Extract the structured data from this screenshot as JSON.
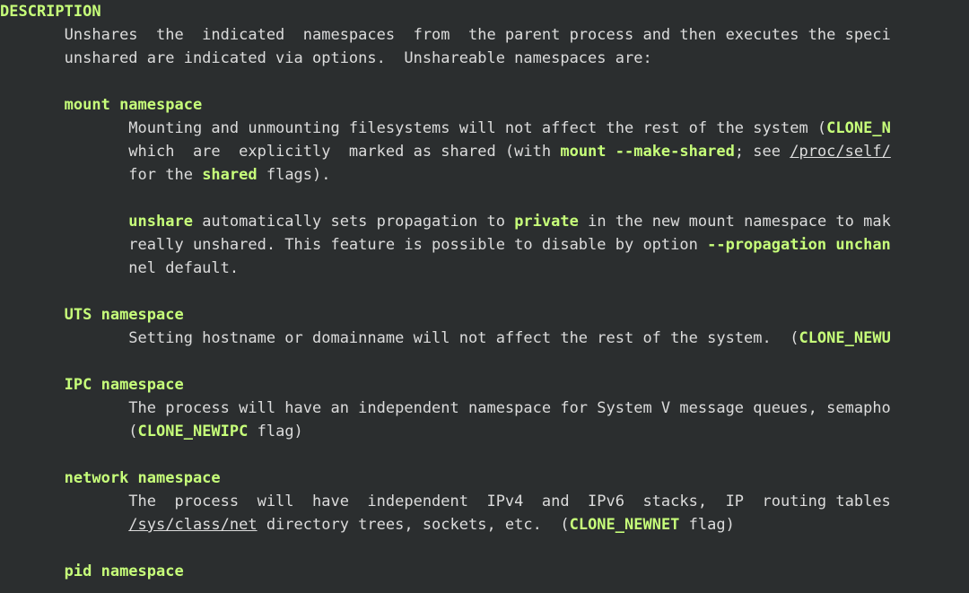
{
  "section_header": "DESCRIPTION",
  "indent_body": "       ",
  "indent_sub": "              ",
  "desc": {
    "l1": "Unshares  the  indicated  namespaces  from  the parent process and then executes the speci",
    "l2": "unshared are indicated via options.  Unshareable namespaces are:"
  },
  "mount": {
    "title": "mount namespace",
    "l1a": "Mounting and unmounting filesystems will not affect the rest of the system (",
    "l1b": "CLONE_N",
    "l2a": "which  are  explicitly  marked as shared (with ",
    "l2b": "mount --make-shared",
    "l2c": "; see ",
    "l2d": "/proc/self/",
    "l3a": "for the ",
    "l3b": "shared",
    "l3c": " flags).",
    "p2l1a": "unshare",
    "p2l1b": " automatically sets propagation to ",
    "p2l1c": "private",
    "p2l1d": " in the new mount namespace to mak",
    "p2l2a": "really unshared. This feature is possible to disable by option ",
    "p2l2b": "--propagation unchan",
    "p2l3": "nel default."
  },
  "uts": {
    "title": "UTS namespace",
    "l1a": "Setting hostname or domainname will not affect the rest of the system.  (",
    "l1b": "CLONE_NEWU"
  },
  "ipc": {
    "title": "IPC namespace",
    "l1": "The process will have an independent namespace for System V message queues, semapho",
    "l2a": "(",
    "l2b": "CLONE_NEWIPC",
    "l2c": " flag)"
  },
  "net": {
    "title": "network namespace",
    "l1": "The  process  will  have  independent  IPv4  and  IPv6  stacks,  IP  routing tables",
    "l2a": "/sys/class/net",
    "l2b": " directory trees, sockets, etc.  (",
    "l2c": "CLONE_NEWNET",
    "l2d": " flag)"
  },
  "pid": {
    "title": "pid namespace"
  }
}
